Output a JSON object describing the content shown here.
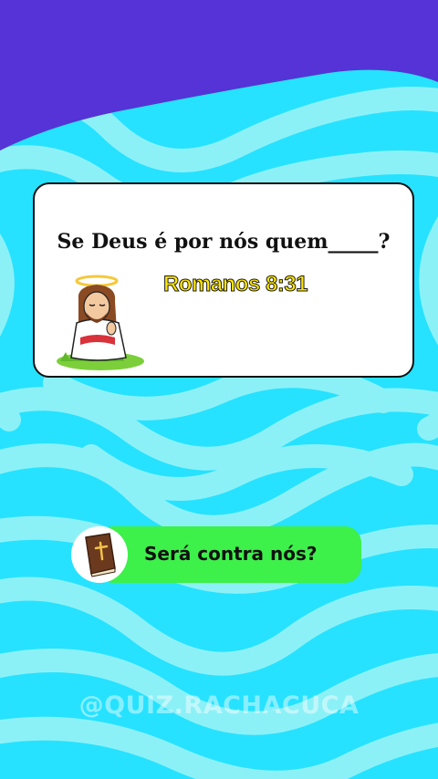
{
  "question": {
    "text": "Se Deus é por nós quem_____?",
    "reference": "Romanos 8:31"
  },
  "answer": {
    "label": "Será contra nós?",
    "icon": "bible-icon"
  },
  "illustration": {
    "icon": "praying-jesus-icon"
  },
  "watermark": {
    "text": "@QUIZ.RACHACUCA"
  },
  "colors": {
    "top_band": "#5533d6",
    "wave_dark": "#26e2ff",
    "wave_light": "#8cf1f7",
    "answer_green": "#3df04a",
    "reference_yellow": "#ffe600"
  }
}
